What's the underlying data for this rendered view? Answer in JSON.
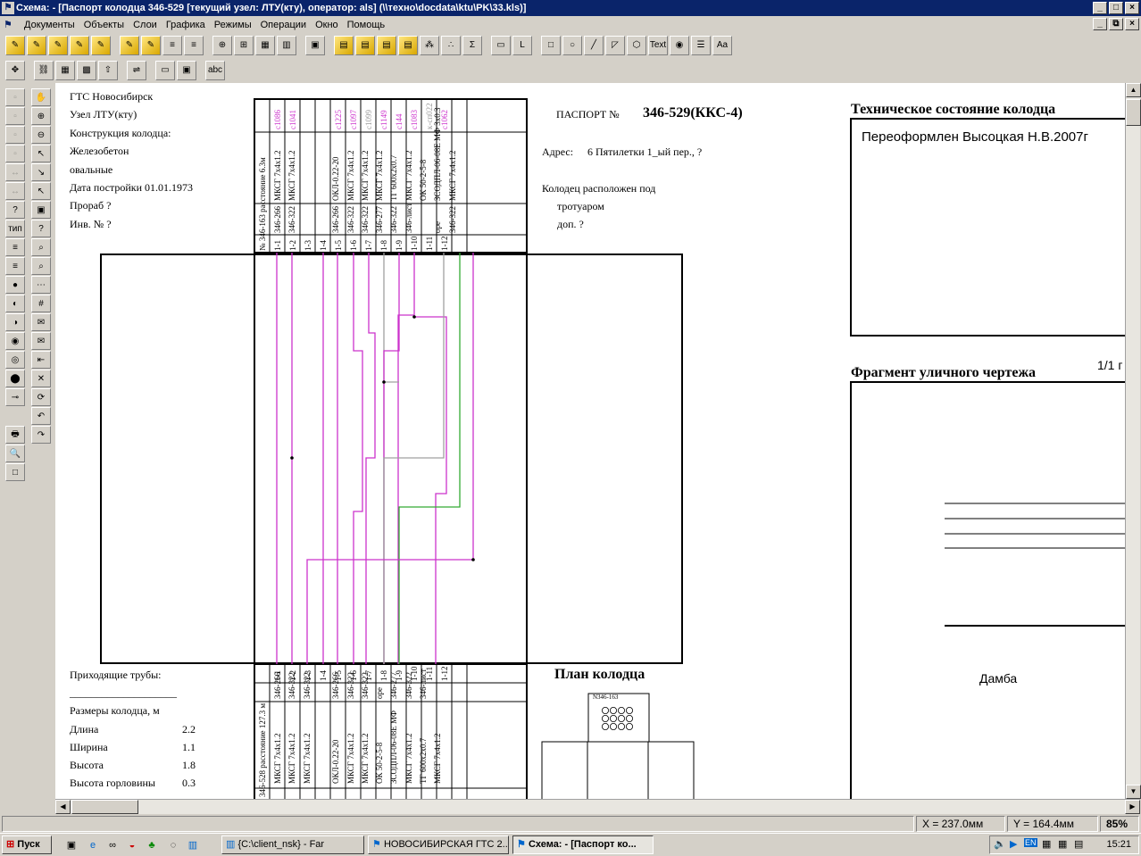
{
  "window": {
    "title": "Схема: - [Паспорт колодца 346-529 [текущий узел: ЛТУ(кту), оператор: als] (\\\\техно\\docdata\\ktu\\PK\\33.kls)]",
    "btn_min": "_",
    "btn_max": "□",
    "btn_close": "×",
    "mdi_min": "_",
    "mdi_restore": "⧉",
    "mdi_close": "×"
  },
  "menu": [
    "Документы",
    "Объекты",
    "Слои",
    "Графика",
    "Режимы",
    "Операции",
    "Окно",
    "Помощь"
  ],
  "toolbar1": [
    {
      "name": "scheme-1-icon",
      "glyph": "✎",
      "style": "y"
    },
    {
      "name": "scheme-2-icon",
      "glyph": "✎",
      "style": "y"
    },
    {
      "name": "scheme-3-icon",
      "glyph": "✎",
      "style": "y"
    },
    {
      "name": "scheme-4-icon",
      "glyph": "✎",
      "style": "y"
    },
    {
      "name": "scheme-5-icon",
      "glyph": "✎",
      "style": "y"
    },
    {
      "name": "sep",
      "glyph": "",
      "style": "sep"
    },
    {
      "name": "scheme-6-icon",
      "glyph": "✎",
      "style": "y"
    },
    {
      "name": "scheme-7-icon",
      "glyph": "✎",
      "style": "y"
    },
    {
      "name": "scheme-8-icon",
      "glyph": "≡",
      "style": ""
    },
    {
      "name": "scheme-9-icon",
      "glyph": "≡",
      "style": ""
    },
    {
      "name": "sep",
      "glyph": "",
      "style": "sep"
    },
    {
      "name": "crosshair-icon",
      "glyph": "⊕",
      "style": ""
    },
    {
      "name": "grid-window-icon",
      "glyph": "⊞",
      "style": ""
    },
    {
      "name": "table-icon",
      "glyph": "▦",
      "style": ""
    },
    {
      "name": "columns-icon",
      "glyph": "▥",
      "style": ""
    },
    {
      "name": "sep",
      "glyph": "",
      "style": "sep"
    },
    {
      "name": "save-icon",
      "glyph": "▣",
      "style": ""
    },
    {
      "name": "sep",
      "glyph": "",
      "style": "sep"
    },
    {
      "name": "layers-1-icon",
      "glyph": "▤",
      "style": "y"
    },
    {
      "name": "layers-2-icon",
      "glyph": "▤",
      "style": "y"
    },
    {
      "name": "layers-3-icon",
      "glyph": "▤",
      "style": "y"
    },
    {
      "name": "layers-4-icon",
      "glyph": "▤",
      "style": "y"
    },
    {
      "name": "network-icon",
      "glyph": "⁂",
      "style": ""
    },
    {
      "name": "nodes-icon",
      "glyph": "∴",
      "style": ""
    },
    {
      "name": "sum-icon",
      "glyph": "Σ",
      "style": ""
    },
    {
      "name": "sep",
      "glyph": "",
      "style": "sep"
    },
    {
      "name": "disabled-1-icon",
      "glyph": "▭",
      "style": ""
    },
    {
      "name": "disabled-2-icon",
      "glyph": "L",
      "style": ""
    },
    {
      "name": "sep",
      "glyph": "",
      "style": "sep"
    },
    {
      "name": "rectangle-icon",
      "glyph": "□",
      "style": ""
    },
    {
      "name": "circle-icon",
      "glyph": "○",
      "style": ""
    },
    {
      "name": "line-icon",
      "glyph": "╱",
      "style": ""
    },
    {
      "name": "polyline-icon",
      "glyph": "◸",
      "style": ""
    },
    {
      "name": "polygon-icon",
      "glyph": "⬡",
      "style": ""
    },
    {
      "name": "text-icon",
      "glyph": "Text",
      "style": ""
    },
    {
      "name": "color-icon",
      "glyph": "◉",
      "style": ""
    },
    {
      "name": "line-style-icon",
      "glyph": "☰",
      "style": ""
    },
    {
      "name": "font-icon",
      "glyph": "Aa",
      "style": ""
    }
  ],
  "toolbar2": [
    {
      "name": "move-icon",
      "glyph": "✥"
    },
    {
      "name": "sep",
      "glyph": ""
    },
    {
      "name": "link-icon",
      "glyph": "⛓"
    },
    {
      "name": "grid-icon",
      "glyph": "▦"
    },
    {
      "name": "snap-icon",
      "glyph": "▩"
    },
    {
      "name": "upload-icon",
      "glyph": "⇧"
    },
    {
      "name": "sep",
      "glyph": ""
    },
    {
      "name": "route-icon",
      "glyph": "⇌"
    },
    {
      "name": "sep",
      "glyph": ""
    },
    {
      "name": "window-icon",
      "glyph": "▭"
    },
    {
      "name": "panel-icon",
      "glyph": "▣"
    },
    {
      "name": "sep",
      "glyph": ""
    },
    {
      "name": "abc-icon",
      "glyph": "abc"
    }
  ],
  "leftbar_col1": [
    "▫",
    "▫",
    "▫",
    "▫",
    "↔",
    "↔",
    "?",
    "тип",
    "≡",
    "≡",
    "●",
    "◐",
    "◑",
    "◉",
    "◎",
    "⬤",
    "⊸",
    "",
    "🖶",
    "🔍",
    "□"
  ],
  "leftbar_col2": [
    "✋",
    "⊕",
    "⊖",
    "↖",
    "↘",
    "↖",
    "▣",
    "?",
    "⌕",
    "⌕",
    "⋯",
    "#",
    "✉",
    "✉",
    "⇤",
    "✕",
    "⟳",
    "↶",
    "↷"
  ],
  "passport": {
    "left_info": [
      "ГТС   Новосибирск",
      "Узел ЛТУ(кту)",
      "Конструкция колодца:",
      "      Железобетон",
      "      овальные",
      "Дата постройки  01.01.1973",
      "Прораб  ?",
      "Инв. №   ?"
    ],
    "passport_label": "ПАСПОРТ №",
    "passport_number": "346-529(ККС-4)",
    "address_label": "Адрес:",
    "address_value": "6 Пятилетки 1_ый пер., ?",
    "location_lines": [
      "Колодец расположен под",
      "тротуаром",
      "доп. ?"
    ],
    "tech_state_title": "Техническое состояние колодца",
    "tech_state_note": "Переоформлен Высоцкая Н.В.2007г",
    "fragment_title": "Фрагмент уличного чертежа",
    "page_counter": "1/1 г",
    "damba": "Дамба",
    "plan_title": "План колодца",
    "plan_sub_label": "N346-163",
    "bottom_info": [
      {
        "label": "Приходящие трубы:",
        "value": ""
      },
      {
        "label": "____________________",
        "value": ""
      },
      {
        "label": "Размеры колодца, м",
        "value": ""
      },
      {
        "label": "    Длина",
        "value": "2.2"
      },
      {
        "label": "    Ширина",
        "value": "1.1"
      },
      {
        "label": "    Высота",
        "value": "1.8"
      },
      {
        "label": "    Высота горловины",
        "value": "0.3"
      }
    ],
    "top_table": {
      "left_header": "№ 346-163   расстояние 6.3м",
      "duct_ids": [
        "1-1",
        "1-2",
        "1-3",
        "1-4",
        "1-5",
        "1-6",
        "1-7",
        "1-8",
        "1-9",
        "1-10",
        "1-11",
        "1-12"
      ],
      "cable_ids": [
        "с1086",
        "с1041",
        "",
        "",
        "с1225",
        "с1097",
        "с1099",
        "с1149",
        "с144",
        "с1083",
        "к-сп022",
        "с1062"
      ],
      "cable_types": [
        "МКСГ 7х4х1.2",
        "МКСГ 7х4х1.2",
        "",
        "",
        "ОКЛ-0.22-20",
        "МКСГ 7х4х1.2",
        "МКСГ 7х4х1.2",
        "МКСГ 7х4х1.2",
        "ТГ 600х2х0.7",
        "МКСГ 7х4х1.2",
        "ОК 50-2-5-8",
        "ЗСОДПЛ-06-08Е МФ 3х0.3",
        "МКСГ 7х4х1.2"
      ],
      "dest": [
        "346-266",
        "346-322",
        "",
        "",
        "346-266",
        "346-322",
        "346-322",
        "346-277",
        "346-322",
        "346-лист",
        "",
        "оре",
        "346-322"
      ]
    },
    "bottom_table": {
      "left_header": "346-528   расстояние 127.3 м",
      "duct_ids": [
        "1-1",
        "1-2",
        "1-3",
        "1-4",
        "1-5",
        "1-6",
        "1-7",
        "1-8",
        "1-9",
        "1-10",
        "1-11",
        "1-12"
      ],
      "dest": [
        "346-266",
        "346-322",
        "346-322",
        "",
        "346-266",
        "346-322",
        "346-322",
        "оре",
        "346-277",
        "346-322",
        "346-лист",
        "",
        ""
      ],
      "cable_types": [
        "МКСГ 7х4х1.2",
        "МКСГ 7х4х1.2",
        "МКСГ 7х4х1.2",
        "",
        "ОКЛ-0.22-20",
        "МКСГ 7х4х1.2",
        "МКСГ 7х4х1.2",
        "ОК 50-2-5-8",
        "ЗСОДПЛ-06-08Е МФ",
        "МКСГ 7х4х1.2",
        "ТГ 600х2х0.7",
        "МКСГ 7х4х1.2",
        ""
      ]
    }
  },
  "status": {
    "x": "X = 237.0мм",
    "y": "Y = 164.4мм",
    "zoom": "85%"
  },
  "taskbar": {
    "start": "Пуск",
    "tasks": [
      {
        "label": "{C:\\client_nsk} - Far",
        "active": false
      },
      {
        "label": "НОВОСИБИРСКАЯ ГТС 2...",
        "active": false
      },
      {
        "label": "Схема: - [Паспорт ко...",
        "active": true
      }
    ],
    "lang": "EN",
    "time": "15:21"
  },
  "colors": {
    "magenta": "#cc33cc",
    "green": "#33aa33",
    "gray": "#a0a0a0",
    "title_blue": "#0a246a"
  }
}
